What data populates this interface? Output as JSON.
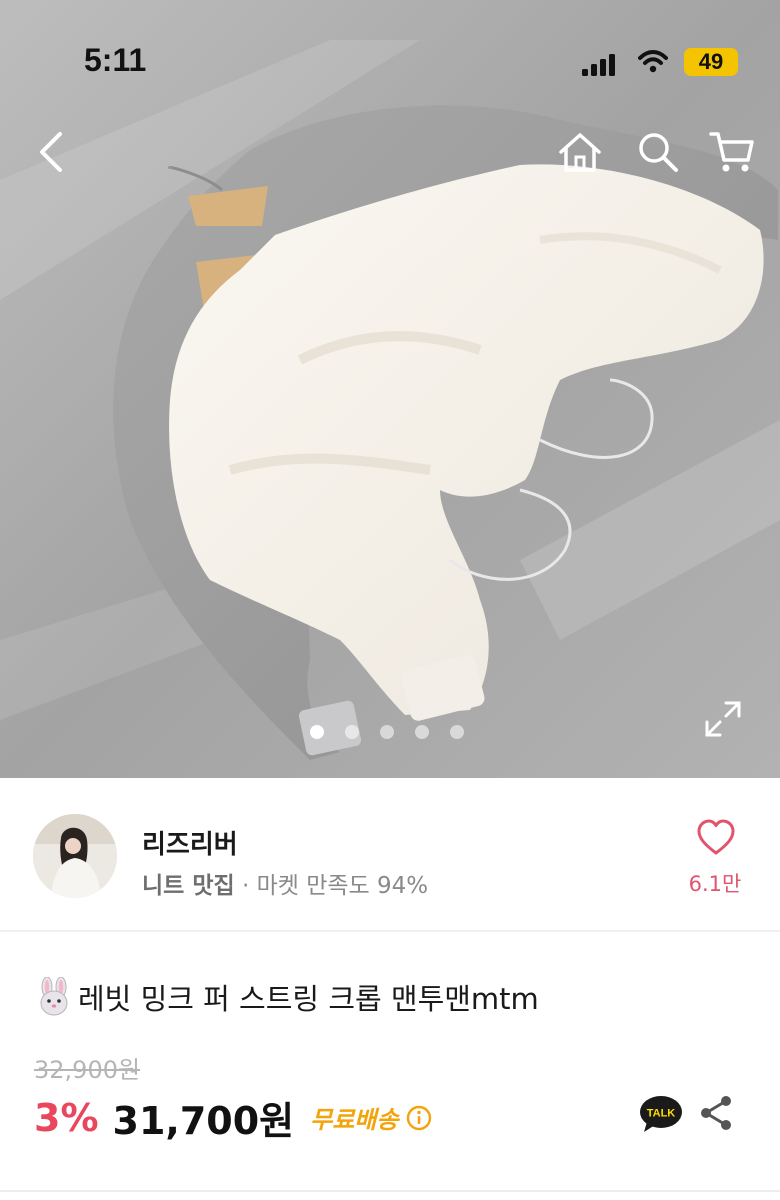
{
  "status_bar": {
    "time": "5:11",
    "battery": "49",
    "signal_icon": "cellular-signal-icon",
    "wifi_icon": "wifi-icon"
  },
  "nav": {
    "back_icon": "chevron-left-icon",
    "home_icon": "home-icon",
    "search_icon": "search-icon",
    "cart_icon": "cart-icon"
  },
  "gallery": {
    "total_images": 5,
    "active_index": 0,
    "expand_icon": "expand-icon"
  },
  "seller": {
    "name": "리즈리버",
    "tag": "니트 맛집",
    "meta": " · 마켓 만족도 94%",
    "likes": "6.1만",
    "heart_icon": "heart-outline-icon"
  },
  "product": {
    "title_emoji": "rabbit-emoji",
    "title": "레빗 밍크 퍼 스트링 크롭 맨투맨mtm",
    "original_price": "32,900원",
    "discount": "3%",
    "price": "31,700원",
    "shipping": "무료배송"
  },
  "actions": {
    "talk_label": "TALK",
    "share_icon": "share-icon"
  },
  "colors": {
    "discount": "#e8475d",
    "shipping": "#f4a40b",
    "heart": "#e0546c",
    "battery": "#f5c400"
  }
}
